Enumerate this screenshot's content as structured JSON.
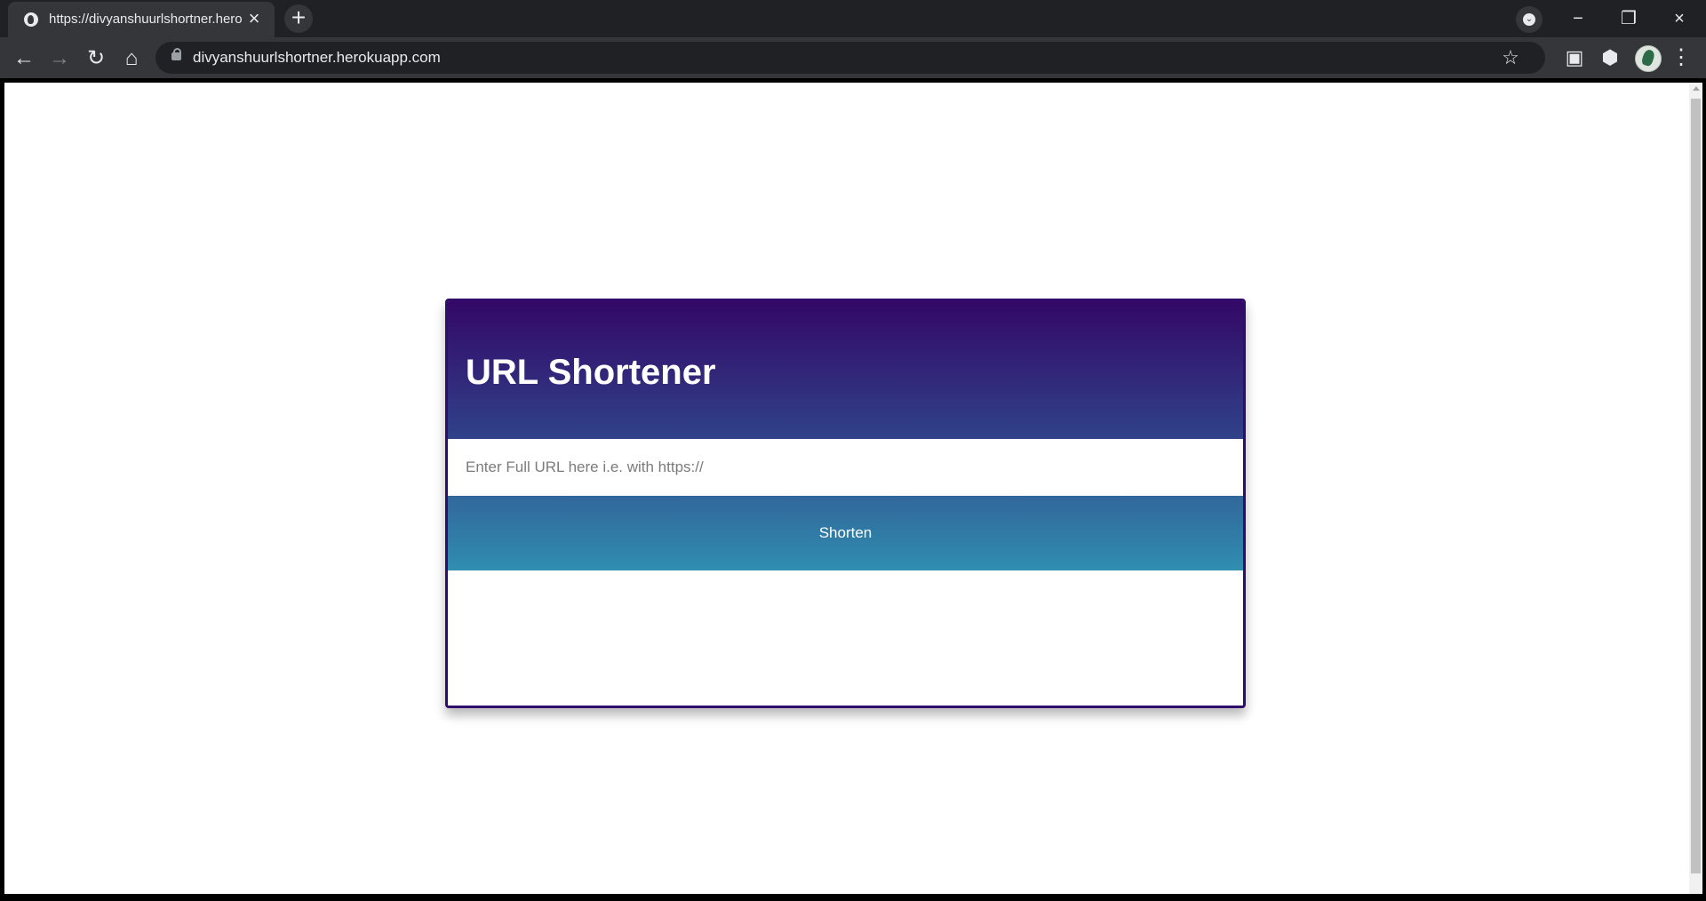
{
  "browser": {
    "tab_title": "https://divyanshuurlshortner.herokuapp.com/",
    "url": "divyanshuurlshortner.herokuapp.com"
  },
  "page": {
    "title": "URL Shortener",
    "input_placeholder": "Enter Full URL here i.e. with https://",
    "button_label": "Shorten",
    "colors": {
      "header_top": "#330867",
      "header_bottom": "#30428a",
      "button_top": "#31679b",
      "button_bottom": "#308eb1",
      "card_border": "#2e0e6a"
    }
  }
}
